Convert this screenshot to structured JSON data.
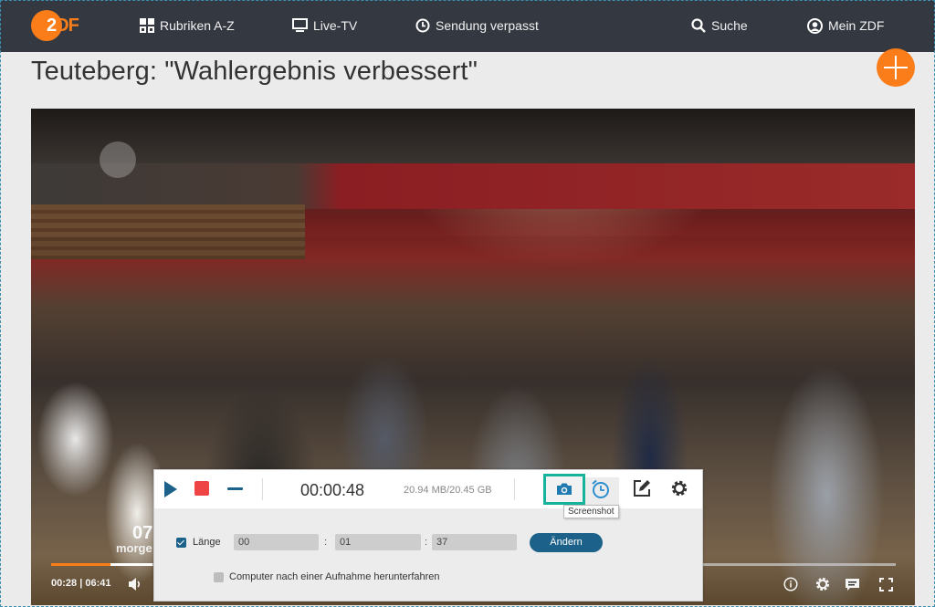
{
  "nav": {
    "logo": {
      "two": "2",
      "df": "DF"
    },
    "items": [
      {
        "label": "Rubriken A-Z",
        "icon": "grid-icon"
      },
      {
        "label": "Live-TV",
        "icon": "tv-icon"
      },
      {
        "label": "Sendung verpasst",
        "icon": "clock-icon"
      },
      {
        "label": "Suche",
        "icon": "search-icon"
      },
      {
        "label": "Mein ZDF",
        "icon": "user-icon"
      }
    ]
  },
  "page": {
    "title": "Teuteberg: \"Wahlergebnis verbessert\"",
    "add_icon": "plus-icon"
  },
  "player": {
    "overlay_number": "07",
    "overlay_text": "morge",
    "current_time": "00:28",
    "separator": "|",
    "duration": "06:41",
    "progress_played_percent": 7,
    "progress_buffered_percent": 12,
    "accent_color": "#fa7d19",
    "controls": [
      "volume-icon",
      "info-icon",
      "settings-icon",
      "subtitles-icon",
      "fullscreen-icon"
    ]
  },
  "recorder": {
    "elapsed": "00:00:48",
    "size": "20.94 MB/20.45 GB",
    "tooltip": "Screenshot",
    "highlight_color": "#16b39c",
    "length": {
      "checked": true,
      "label": "Länge",
      "hours": "00",
      "minutes": "01",
      "seconds": "37",
      "separator": ":"
    },
    "change_button": "Ändern",
    "shutdown": {
      "checked": false,
      "label": "Computer nach einer Aufnahme herunterfahren"
    }
  }
}
